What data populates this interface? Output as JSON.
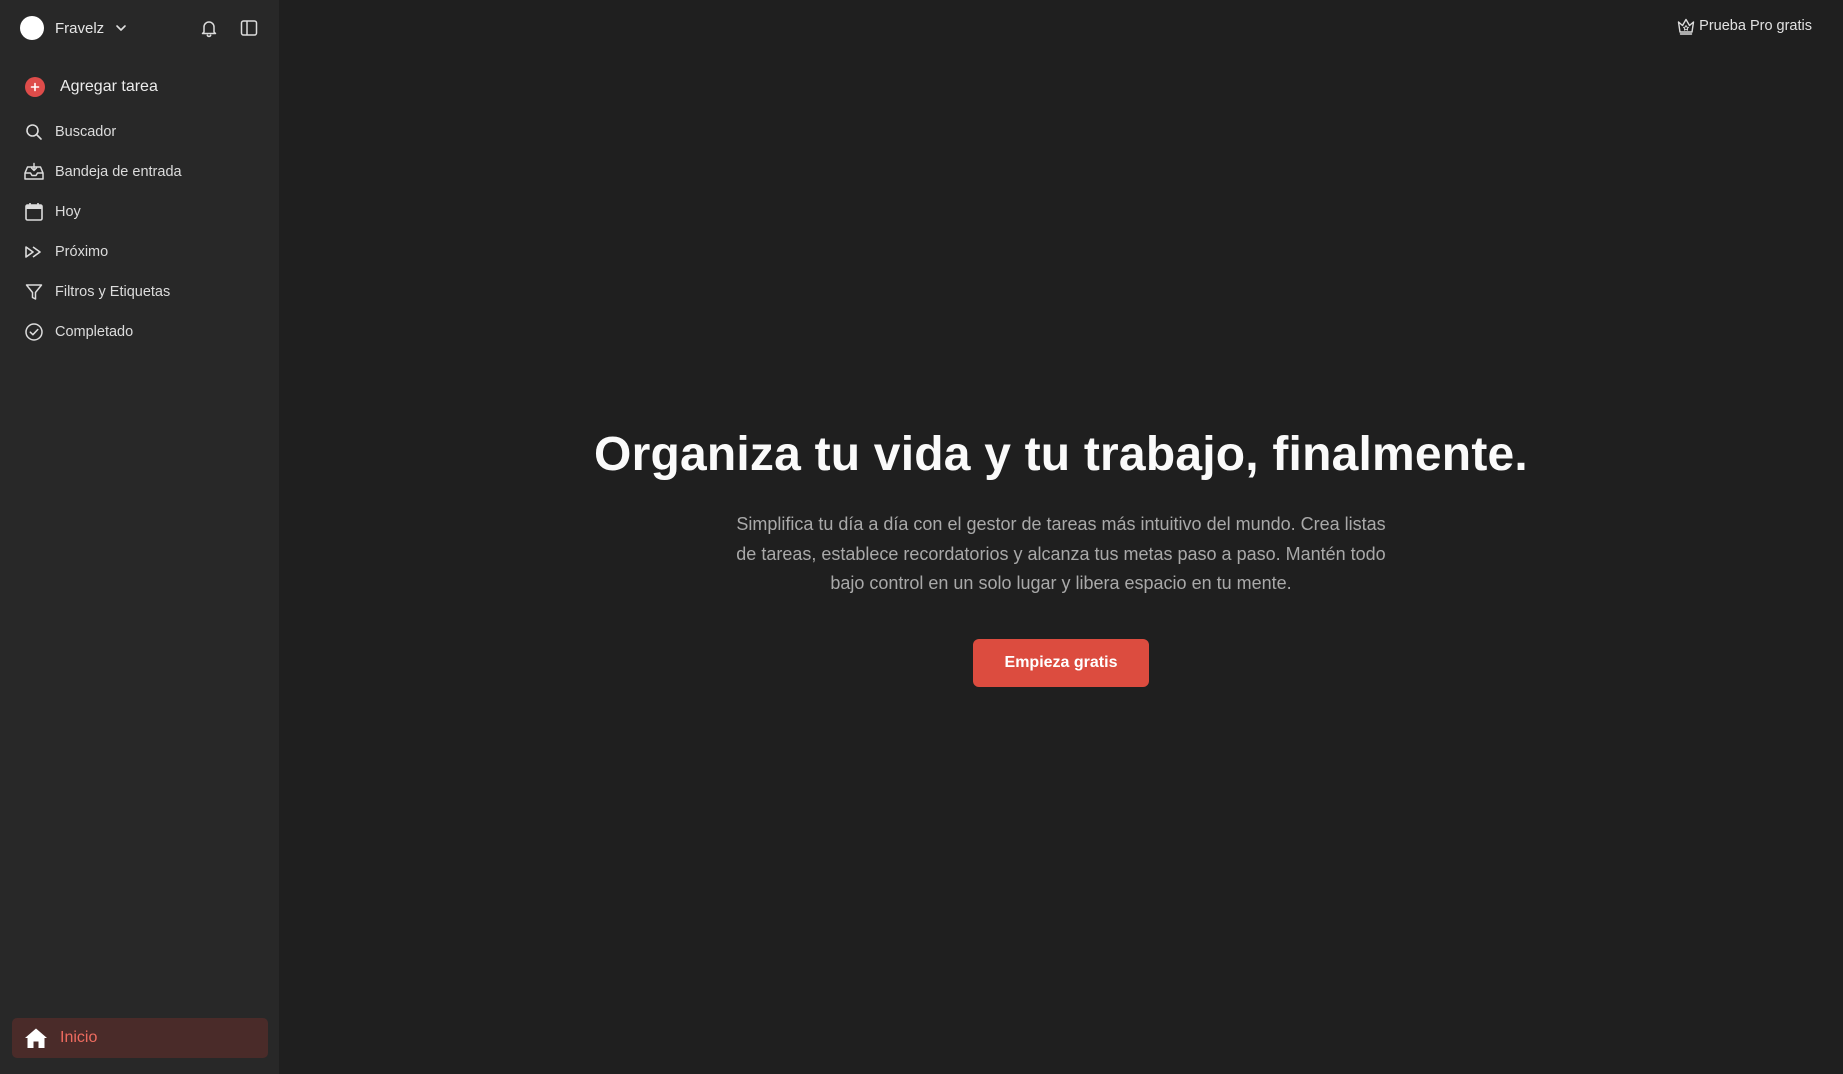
{
  "account": {
    "name": "Fravelz"
  },
  "sidebar": {
    "add_task": "Agregar tarea",
    "items": [
      {
        "label": "Buscador",
        "icon": "search-icon"
      },
      {
        "label": "Bandeja de entrada",
        "icon": "inbox-icon"
      },
      {
        "label": "Hoy",
        "icon": "calendar-icon"
      },
      {
        "label": "Próximo",
        "icon": "upcoming-icon"
      },
      {
        "label": "Filtros y Etiquetas",
        "icon": "filter-icon"
      },
      {
        "label": "Completado",
        "icon": "check-circle-icon"
      }
    ],
    "home": "Inicio"
  },
  "header": {
    "pro_label": "Prueba Pro gratis"
  },
  "hero": {
    "title": "Organiza tu vida y tu trabajo, finalmente.",
    "description": "Simplifica tu día a día con el gestor de tareas más intuitivo del mundo. Crea listas de tareas, establece recordatorios y alcanza tus metas paso a paso. Mantén todo bajo control en un solo lugar y libera espacio en tu mente.",
    "cta": "Empieza gratis"
  },
  "colors": {
    "background": "#1f1f1f",
    "sidebar": "#282828",
    "accent": "#dc4c3f",
    "home_active_bg": "#4a2b29",
    "home_active_text": "#ee6b5f"
  }
}
